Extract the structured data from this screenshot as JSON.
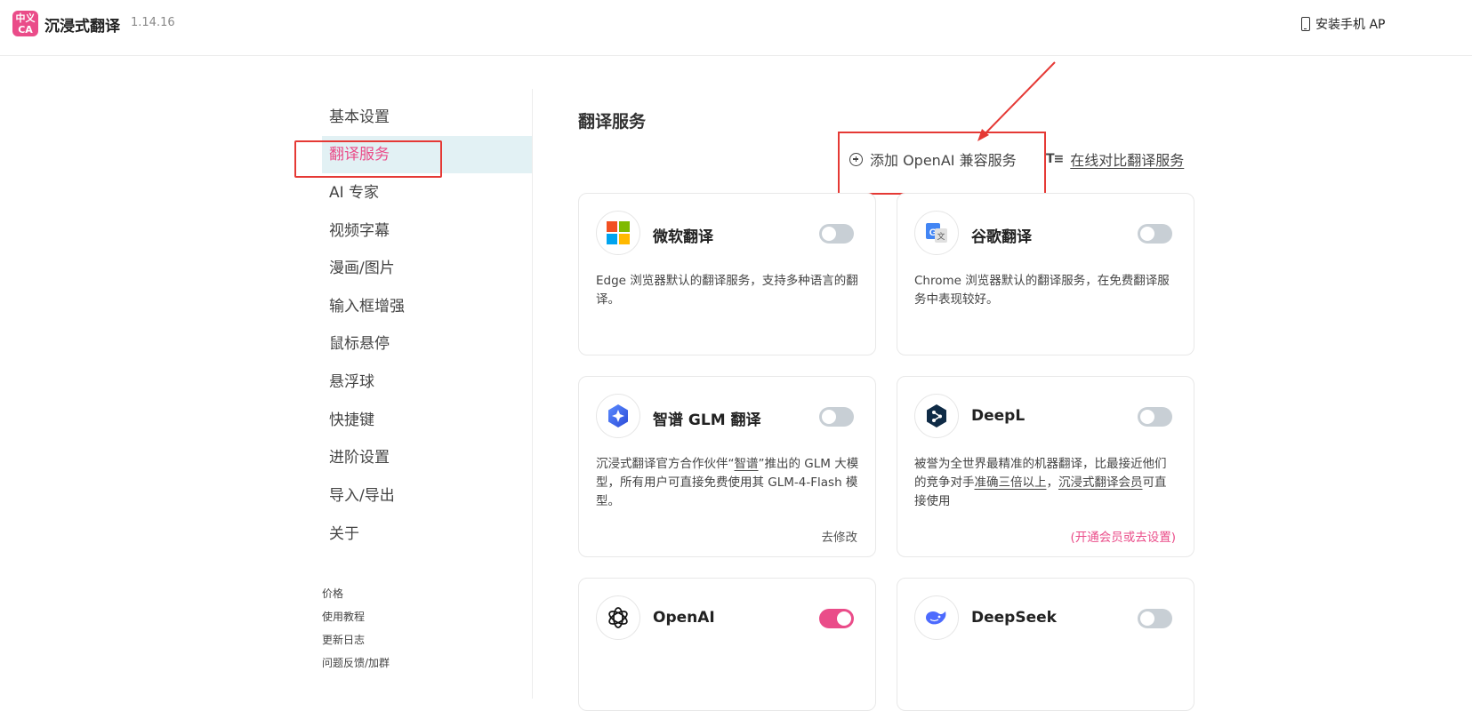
{
  "header": {
    "logo_top": "中义",
    "logo_bottom": "CA",
    "app_name": "沉浸式翻译",
    "version": "1.14.16",
    "install_mobile": "安装手机 AP"
  },
  "sidebar": {
    "items": [
      {
        "label": "基本设置"
      },
      {
        "label": "翻译服务"
      },
      {
        "label": "AI 专家"
      },
      {
        "label": "视频字幕"
      },
      {
        "label": "漫画/图片"
      },
      {
        "label": "输入框增强"
      },
      {
        "label": "鼠标悬停"
      },
      {
        "label": "悬浮球"
      },
      {
        "label": "快捷键"
      },
      {
        "label": "进阶设置"
      },
      {
        "label": "导入/导出"
      },
      {
        "label": "关于"
      }
    ],
    "active_index": 1,
    "footer_links": [
      "价格",
      "使用教程",
      "更新日志",
      "问题反馈/加群"
    ]
  },
  "main": {
    "title": "翻译服务",
    "add_openai_label": "添加 OpenAI 兼容服务",
    "compare_label": "在线对比翻译服务",
    "services": [
      {
        "name": "微软翻译",
        "icon": "microsoft-icon",
        "enabled": false,
        "desc": "Edge 浏览器默认的翻译服务，支持多种语言的翻译。",
        "action": ""
      },
      {
        "name": "谷歌翻译",
        "icon": "google-translate-icon",
        "enabled": false,
        "desc": "Chrome 浏览器默认的翻译服务，在免费翻译服务中表现较好。",
        "action": ""
      },
      {
        "name": "智谱 GLM 翻译",
        "icon": "zhipu-icon",
        "enabled": false,
        "desc_a": "沉浸式翻译官方合作伙伴“",
        "desc_u": "智谱",
        "desc_b": "”推出的 GLM 大模型，所有用户可直接免费使用其 GLM-4-Flash 模型。",
        "action": "去修改"
      },
      {
        "name": "DeepL",
        "icon": "deepl-icon",
        "enabled": false,
        "desc_a": "被誉为全世界最精准的机器翻译，比最接近他们的竞争对手",
        "desc_u": "准确三倍以上",
        "desc_mid": "，",
        "desc_u2": "沉浸式翻译会员",
        "desc_b": "可直接使用",
        "action": "(开通会员或去设置)"
      },
      {
        "name": "OpenAI",
        "icon": "openai-icon",
        "enabled": true,
        "desc": "",
        "action": ""
      },
      {
        "name": "DeepSeek",
        "icon": "deepseek-icon",
        "enabled": false,
        "desc": "",
        "action": ""
      }
    ]
  },
  "colors": {
    "accent": "#ea4c89",
    "active_bg": "#e2f1f4",
    "annotation": "#e53935"
  }
}
